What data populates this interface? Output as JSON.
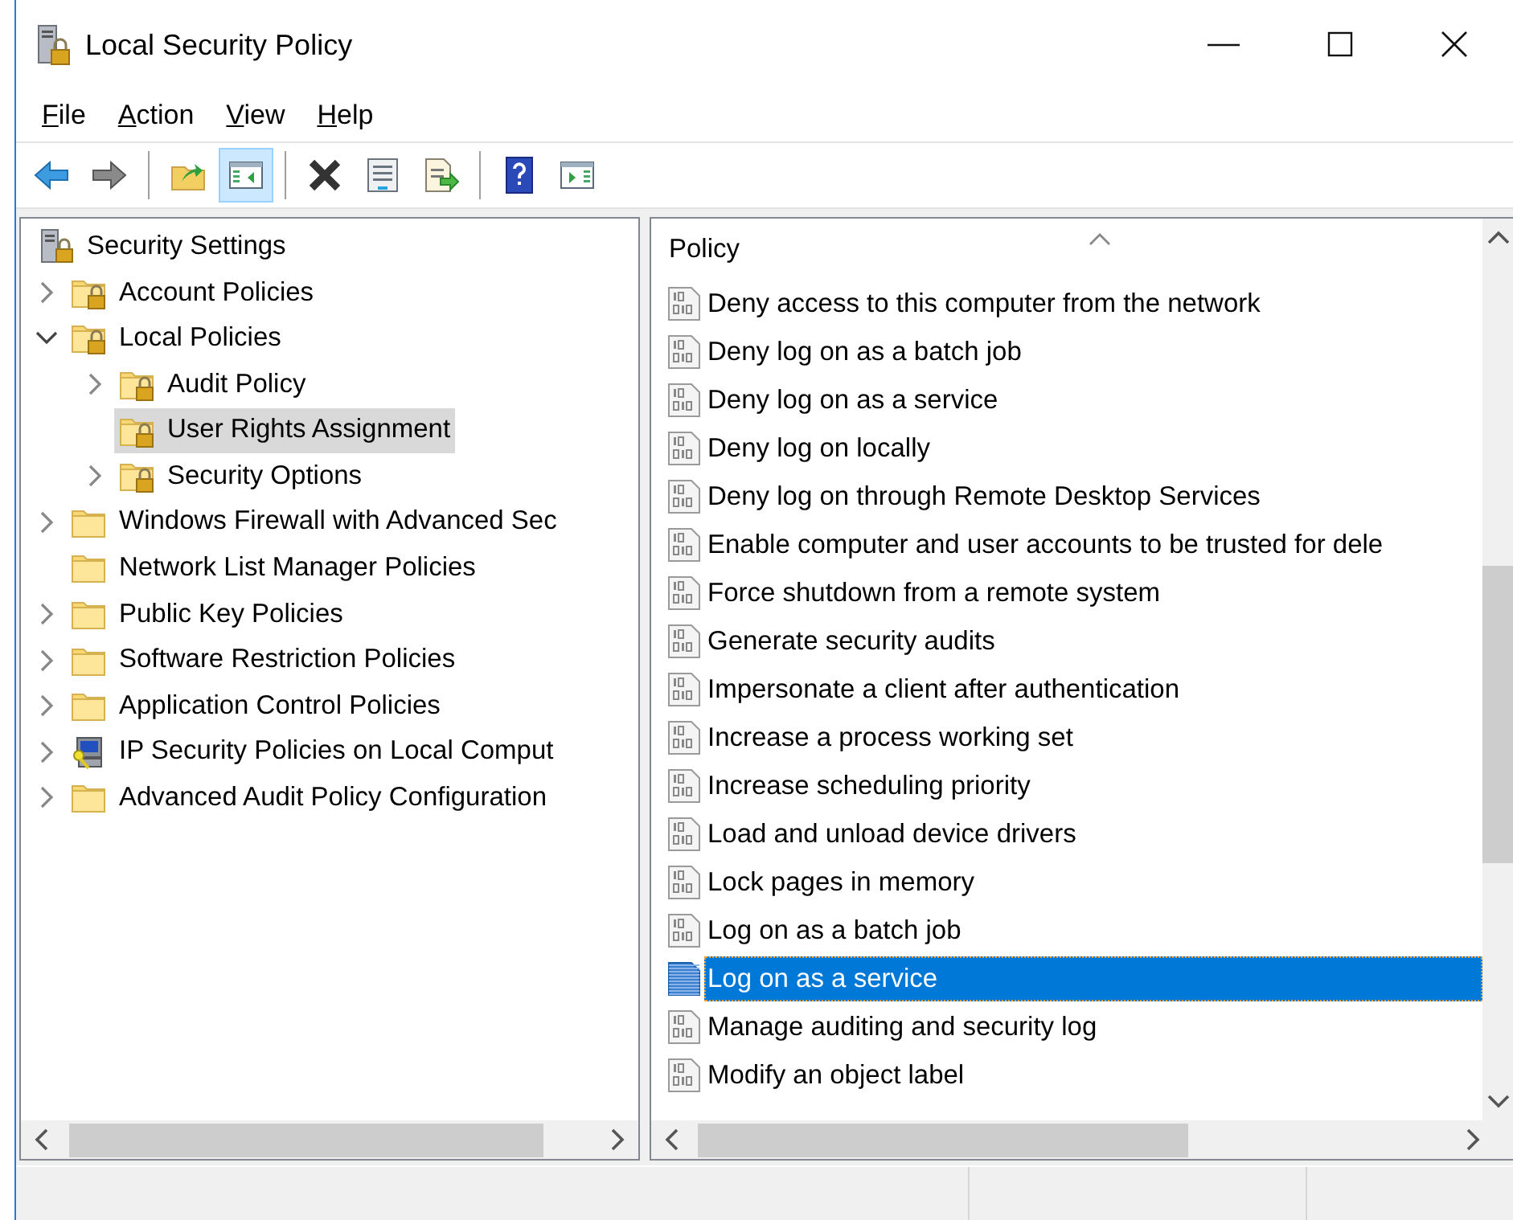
{
  "window": {
    "title": "Local Security Policy"
  },
  "menu": [
    "File",
    "Action",
    "View",
    "Help"
  ],
  "toolbar": [
    [
      {
        "kind": "back",
        "pressed": false
      },
      {
        "kind": "forward",
        "pressed": false
      }
    ],
    [
      {
        "kind": "up",
        "pressed": false
      },
      {
        "kind": "console-tree",
        "pressed": true
      }
    ],
    [
      {
        "kind": "delete",
        "pressed": false
      },
      {
        "kind": "properties",
        "pressed": false
      },
      {
        "kind": "export",
        "pressed": false
      }
    ],
    [
      {
        "kind": "help",
        "pressed": false
      },
      {
        "kind": "action-pane",
        "pressed": false
      }
    ]
  ],
  "tree": [
    {
      "label": "Security Settings",
      "kind": "server",
      "selected": false,
      "children": [
        {
          "label": "Account Policies",
          "kind": "folder-lock",
          "expanded": false,
          "selected": false
        },
        {
          "label": "Local Policies",
          "kind": "folder-lock",
          "expanded": true,
          "selected": false,
          "children": [
            {
              "label": "Audit Policy",
              "kind": "folder-lock",
              "expanded": false,
              "selected": false
            },
            {
              "label": "User Rights Assignment",
              "kind": "folder-lock",
              "selected": true
            },
            {
              "label": "Security Options",
              "kind": "folder-lock",
              "expanded": false,
              "selected": false
            }
          ]
        },
        {
          "label": "Windows Firewall with Advanced Sec",
          "kind": "folder",
          "expanded": false,
          "selected": false
        },
        {
          "label": "Network List Manager Policies",
          "kind": "folder",
          "selected": false
        },
        {
          "label": "Public Key Policies",
          "kind": "folder",
          "expanded": false,
          "selected": false
        },
        {
          "label": "Software Restriction Policies",
          "kind": "folder",
          "expanded": false,
          "selected": false
        },
        {
          "label": "Application Control Policies",
          "kind": "folder",
          "expanded": false,
          "selected": false
        },
        {
          "label": "IP Security Policies on Local Comput",
          "kind": "ip-security",
          "expanded": false,
          "selected": false
        },
        {
          "label": "Advanced Audit Policy Configuration",
          "kind": "folder",
          "expanded": false,
          "selected": false
        }
      ]
    }
  ],
  "list": {
    "column": "Policy",
    "sort_ascending": true,
    "rows": [
      {
        "label": "Deny access to this computer from the network",
        "selected": false
      },
      {
        "label": "Deny log on as a batch job",
        "selected": false
      },
      {
        "label": "Deny log on as a service",
        "selected": false
      },
      {
        "label": "Deny log on locally",
        "selected": false
      },
      {
        "label": "Deny log on through Remote Desktop Services",
        "selected": false
      },
      {
        "label": "Enable computer and user accounts to be trusted for dele",
        "selected": false
      },
      {
        "label": "Force shutdown from a remote system",
        "selected": false
      },
      {
        "label": "Generate security audits",
        "selected": false
      },
      {
        "label": "Impersonate a client after authentication",
        "selected": false
      },
      {
        "label": "Increase a process working set",
        "selected": false
      },
      {
        "label": "Increase scheduling priority",
        "selected": false
      },
      {
        "label": "Load and unload device drivers",
        "selected": false
      },
      {
        "label": "Lock pages in memory",
        "selected": false
      },
      {
        "label": "Log on as a batch job",
        "selected": false
      },
      {
        "label": "Log on as a service",
        "selected": true
      },
      {
        "label": "Manage auditing and security log",
        "selected": false
      },
      {
        "label": "Modify an object label",
        "selected": false
      }
    ]
  }
}
